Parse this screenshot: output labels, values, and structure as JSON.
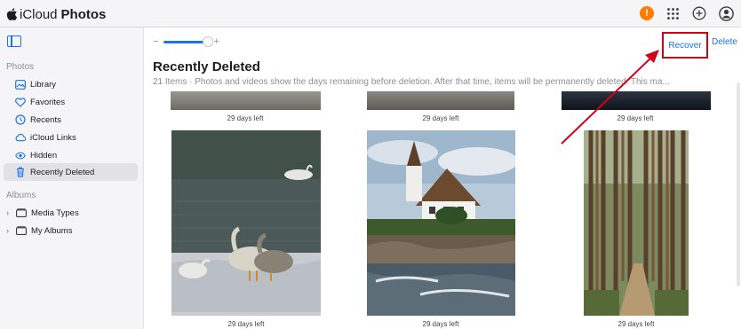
{
  "app": {
    "brand_prefix": "iCloud",
    "brand_name": "Photos",
    "alert_badge": "!"
  },
  "topbar_icons": [
    "apps-grid-icon",
    "add-icon",
    "account-icon"
  ],
  "sidebar": {
    "photos_section": "Photos",
    "albums_section": "Albums",
    "items": [
      {
        "label": "Library",
        "icon": "library-icon"
      },
      {
        "label": "Favorites",
        "icon": "heart-icon"
      },
      {
        "label": "Recents",
        "icon": "clock-icon"
      },
      {
        "label": "iCloud Links",
        "icon": "cloud-link-icon"
      },
      {
        "label": "Hidden",
        "icon": "eye-icon"
      },
      {
        "label": "Recently Deleted",
        "icon": "trash-icon",
        "active": true
      }
    ],
    "albums": [
      {
        "label": "Media Types",
        "icon": "folder-icon"
      },
      {
        "label": "My Albums",
        "icon": "folder-icon"
      }
    ]
  },
  "toolbar": {
    "zoom_minus": "−",
    "zoom_plus": "+",
    "recover_label": "Recover",
    "delete_label": "Delete"
  },
  "main": {
    "title": "Recently Deleted",
    "subtitle": "21 Items  ·  Photos and videos show the days remaining before deletion. After that time, items will be permanently deleted. This ma..."
  },
  "grid": {
    "top_row_captions": [
      "29 days left",
      "29 days left",
      "29 days left"
    ],
    "photos": [
      {
        "subject": "swans-lake",
        "caption": "29 days left"
      },
      {
        "subject": "house-river",
        "caption": "29 days left"
      },
      {
        "subject": "pine-forest-path",
        "caption": "29 days left"
      }
    ]
  },
  "colors": {
    "accent": "#1a73e8",
    "highlight": "#d0021b",
    "alert": "#ff7a00",
    "sidebar_bg": "#f5f5f7"
  }
}
